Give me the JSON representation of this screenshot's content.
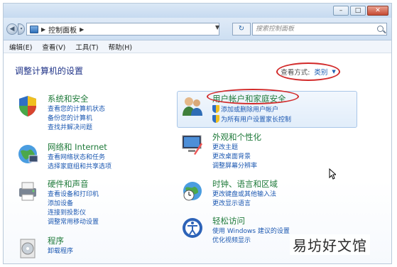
{
  "address": {
    "crumb": "控制面板",
    "search_placeholder": "搜索控制面板"
  },
  "menu": [
    "编辑(E)",
    "查看(V)",
    "工具(T)",
    "帮助(H)"
  ],
  "page": {
    "heading": "调整计算机的设置",
    "view_by_label": "查看方式:",
    "view_by_value": "类别"
  },
  "categories": [
    {
      "title": "系统和安全",
      "links": [
        "查看您的计算机状态",
        "备份您的计算机",
        "查找并解决问题"
      ]
    },
    {
      "title": "网络和 Internet",
      "links": [
        "查看网络状态和任务",
        "选择家庭组和共享选项"
      ]
    },
    {
      "title": "硬件和声音",
      "links": [
        "查看设备和打印机",
        "添加设备",
        "连接到投影仪",
        "调整常用移动设置"
      ]
    },
    {
      "title": "程序",
      "links": [
        "卸载程序"
      ]
    },
    {
      "title": "用户帐户和家庭安全",
      "links": [
        "添加或删除用户帐户",
        "为所有用户设置家长控制"
      ]
    },
    {
      "title": "外观和个性化",
      "links": [
        "更改主题",
        "更改桌面背景",
        "调整屏幕分辨率"
      ]
    },
    {
      "title": "时钟、语言和区域",
      "links": [
        "更改键盘或其他输入法",
        "更改显示语言"
      ]
    },
    {
      "title": "轻松访问",
      "links": [
        "使用 Windows 建议的设置",
        "优化视频显示"
      ]
    }
  ],
  "watermark": "易坊好文馆",
  "colors": {
    "category_title": "#1f7a3a",
    "link": "#1c58b1",
    "annotation": "#d22a2a"
  }
}
